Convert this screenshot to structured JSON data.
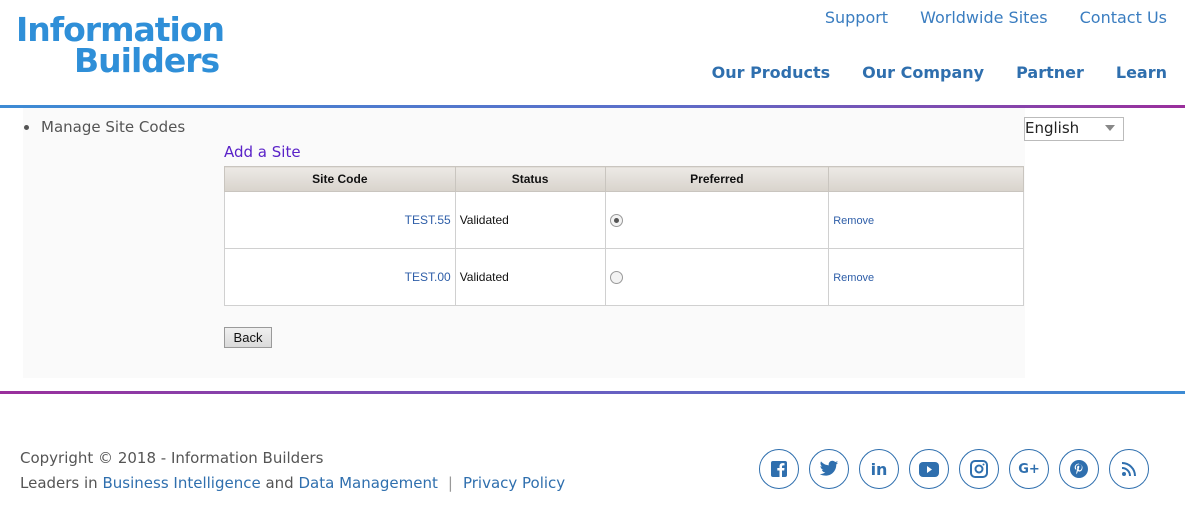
{
  "brand": {
    "line1": "Information",
    "line2": "Builders"
  },
  "top_links": [
    "Support",
    "Worldwide Sites",
    "Contact Us"
  ],
  "main_nav": [
    "Our Products",
    "Our Company",
    "Partner",
    "Learn"
  ],
  "sidebar": {
    "item": "Manage Site Codes"
  },
  "language": {
    "selected": "English"
  },
  "actions": {
    "add_site": "Add a Site",
    "back": "Back"
  },
  "table": {
    "headers": [
      "Site Code",
      "Status",
      "Preferred",
      ""
    ],
    "rows": [
      {
        "code": "TEST.55",
        "status": "Validated",
        "preferred": true,
        "action": "Remove"
      },
      {
        "code": "TEST.00",
        "status": "Validated",
        "preferred": false,
        "action": "Remove"
      }
    ]
  },
  "footer": {
    "copyright": "Copyright © 2018 - Information Builders",
    "leaders_prefix": "Leaders in",
    "bi": "Business Intelligence",
    "and": "and",
    "dm": "Data Management",
    "separator": "|",
    "privacy": "Privacy Policy"
  },
  "social": [
    "facebook-icon",
    "twitter-icon",
    "linkedin-icon",
    "youtube-icon",
    "instagram-icon",
    "google-plus-icon",
    "pinterest-icon",
    "rss-icon"
  ],
  "colors": {
    "brand_blue": "#2f8fd8",
    "link_blue": "#2f6fae",
    "purple": "#9a2f9c"
  }
}
